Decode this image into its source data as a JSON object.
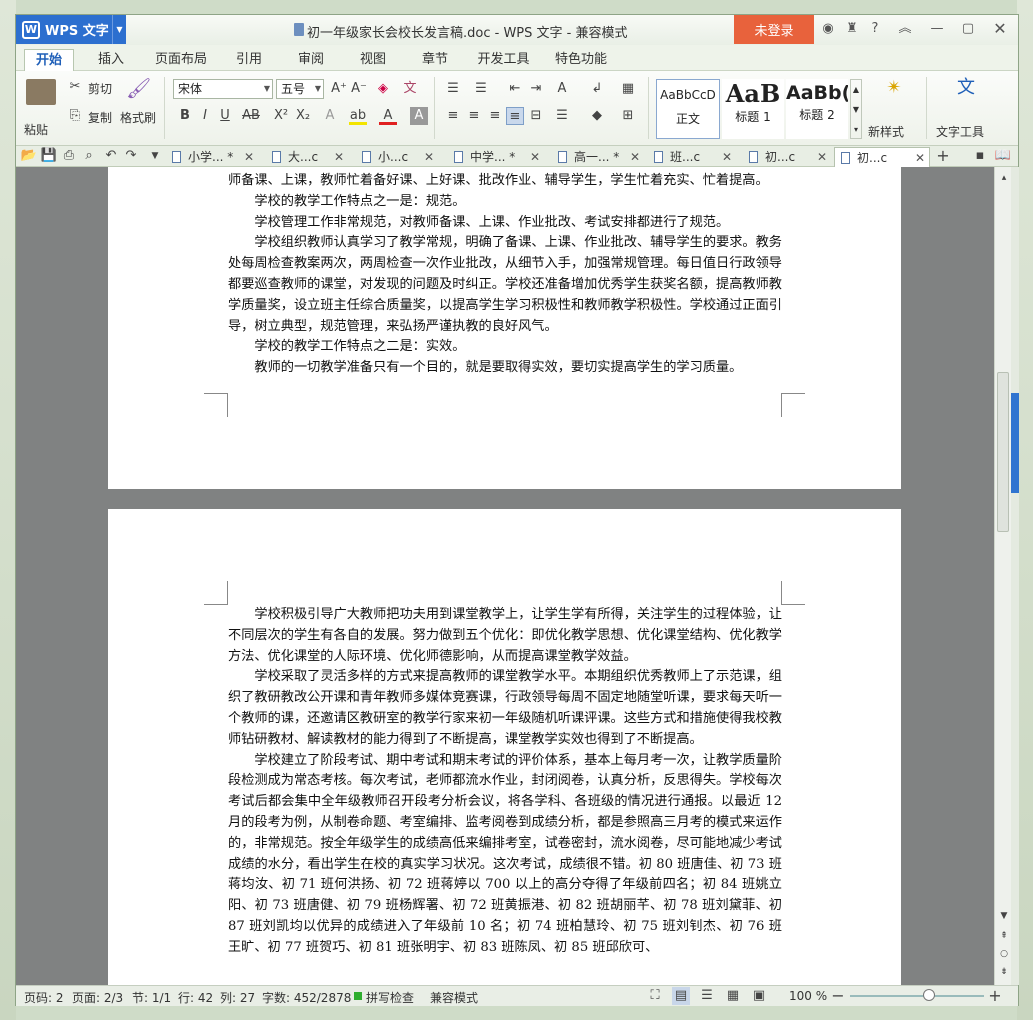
{
  "app": {
    "name": "WPS 文字",
    "doc_title": "初一年级家长会校长发言稿.doc - WPS 文字 - 兼容模式",
    "login": "未登录"
  },
  "menu": [
    "开始",
    "插入",
    "页面布局",
    "引用",
    "审阅",
    "视图",
    "章节",
    "开发工具",
    "特色功能"
  ],
  "ribbon": {
    "paste": "粘贴",
    "cut": "剪切",
    "copy": "复制",
    "format_painter": "格式刷",
    "font": "宋体",
    "size": "五号",
    "styles": [
      {
        "preview": "AaBbCcD",
        "label": "正文"
      },
      {
        "preview": "AaB",
        "label": "标题 1"
      },
      {
        "preview": "AaBb(",
        "label": "标题 2"
      }
    ],
    "new_style": "新样式",
    "text_tool": "文字工具"
  },
  "tabs": [
    "小学... *",
    "大...c",
    "小...c",
    "中学... *",
    "高一... *",
    "班...c",
    "初...c",
    "初...c"
  ],
  "page1_lines": [
    "师备课、上课，教师忙着备好课、上好课、批改作业、辅导学生，学生忙着充实、忙着提高。",
    "学校的教学工作特点之一是：规范。",
    "学校管理工作非常规范，对教师备课、上课、作业批改、考试安排都进行了规范。",
    "学校组织教师认真学习了教学常规，明确了备课、上课、作业批改、辅导学生的要求。教务处每周检查教案两次，两周检查一次作业批改，从细节入手，加强常规管理。每日值日行政领导都要巡查教师的课堂，对发现的问题及时纠正。学校还准备增加优秀学生获奖名额，提高教师教学质量奖，设立班主任综合质量奖，以提高学生学习积极性和教师教学积极性。学校通过正面引导，树立典型，规范管理，来弘扬严谨执教的良好风气。",
    "学校的教学工作特点之二是：实效。",
    "教师的一切教学准备只有一个目的，就是要取得实效，要切实提高学生的学习质量。"
  ],
  "page2_paras": [
    "学校积极引导广大教师把功夫用到课堂教学上，让学生学有所得，关注学生的过程体验，让不同层次的学生有各自的发展。努力做到五个优化：即优化教学思想、优化课堂结构、优化教学方法、优化课堂的人际环境、优化师德影响，从而提高课堂教学效益。",
    "学校采取了灵活多样的方式来提高教师的课堂教学水平。本期组织优秀教师上了示范课，组织了教研教改公开课和青年教师多媒体竞赛课，行政领导每周不固定地随堂听课，要求每天听一个教师的课，还邀请区教研室的教学行家来初一年级随机听课评课。这些方式和措施使得我校教师钻研教材、解读教材的能力得到了不断提高，课堂教学实效也得到了不断提高。",
    "学校建立了阶段考试、期中考试和期末考试的评价体系，基本上每月考一次，让教学质量阶段检测成为常态考核。每次考试，老师都流水作业，封闭阅卷，认真分析，反思得失。学校每次考试后都会集中全年级教师召开段考分析会议，将各学科、各班级的情况进行通报。以最近 12 月的段考为例，从制卷命题、考室编排、监考阅卷到成绩分析，都是参照高三月考的模式来运作的，非常规范。按全年级学生的成绩高低来编排考室，试卷密封，流水阅卷，尽可能地减少考试成绩的水分，看出学生在校的真实学习状况。这次考试，成绩很不错。初 80 班唐佳、初 73 班蒋均汝、初 71 班何洪扬、初 72 班蒋婷以 700 以上的高分夺得了年级前四名；初 84 班姚立阳、初 73 班唐健、初 79 班杨辉署、初 72 班黄振港、初 82 班胡丽芊、初 78 班刘黛菲、初 87 班刘凯均以优异的成绩进入了年级前 10 名；初 74 班柏慧玲、初 75 班刘钊杰、初 76 班王旷、初 77 班贺巧、初 81 班张明宇、初 83 班陈凤、初 85 班邱欣可、"
  ],
  "status": {
    "page_no": "页码: 2",
    "pages": "页面: 2/3",
    "section": "节: 1/1",
    "row": "行: 42",
    "col": "列: 27",
    "words": "字数: 452/2878",
    "spell": "拼写检查",
    "compat": "兼容模式",
    "zoom": "100 %"
  },
  "zoom_level": 100
}
